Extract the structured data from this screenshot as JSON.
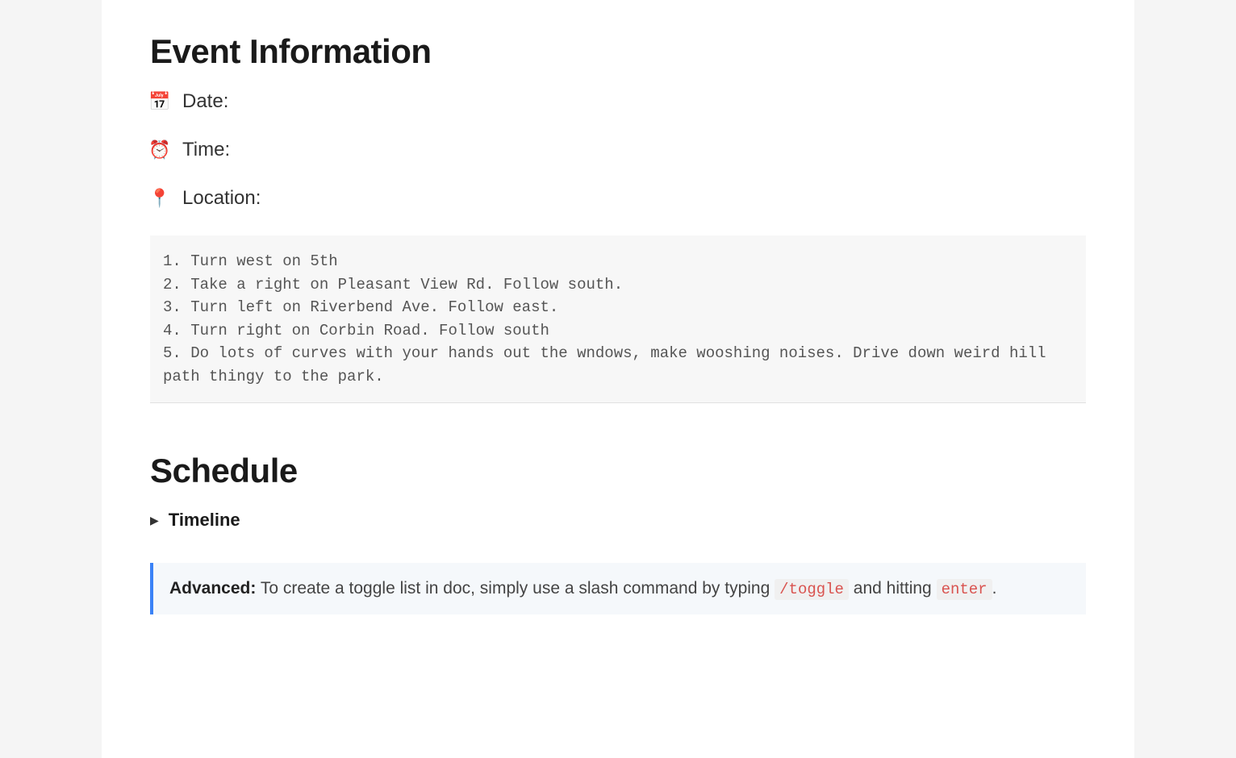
{
  "event_info": {
    "heading": "Event Information",
    "fields": [
      {
        "icon": "📅",
        "label": "Date:"
      },
      {
        "icon": "⏰",
        "label": "Time:"
      },
      {
        "icon": "📍",
        "label": "Location:"
      }
    ],
    "directions": "1. Turn west on 5th\n2. Take a right on Pleasant View Rd. Follow south.\n3. Turn left on Riverbend Ave. Follow east.\n4. Turn right on Corbin Road. Follow south\n5. Do lots of curves with your hands out the wndows, make wooshing noises. Drive down weird hill path thingy to the park."
  },
  "schedule": {
    "heading": "Schedule",
    "toggle_label": "Timeline"
  },
  "callout": {
    "strong": "Advanced:",
    "text_1": " To create a toggle list in doc, simply use a slash command by typing ",
    "code_1": "/toggle",
    "text_2": " and hitting ",
    "code_2": "enter",
    "text_3": "."
  }
}
